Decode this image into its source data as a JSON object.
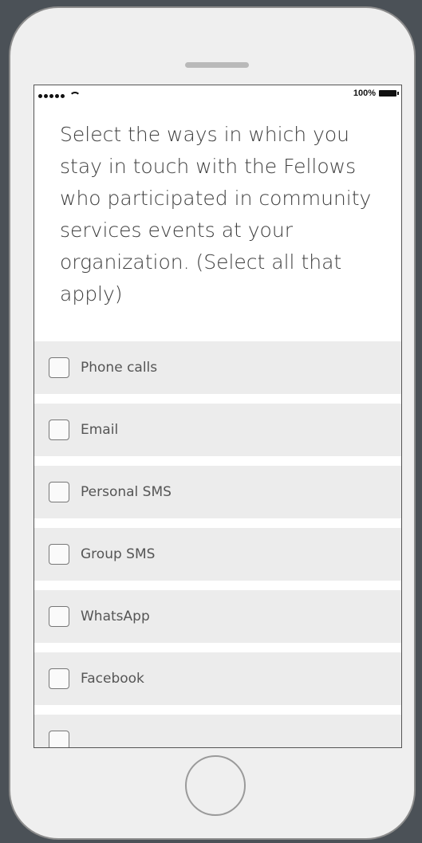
{
  "status_bar": {
    "battery_text": "100%"
  },
  "question": {
    "text": "Select the ways in which you stay in touch with the Fellows who participated in community services events at your organization. (Select all that apply)"
  },
  "options": [
    {
      "label": "Phone calls",
      "checked": false
    },
    {
      "label": "Email",
      "checked": false
    },
    {
      "label": "Personal SMS",
      "checked": false
    },
    {
      "label": "Group SMS",
      "checked": false
    },
    {
      "label": "WhatsApp",
      "checked": false
    },
    {
      "label": "Facebook",
      "checked": false
    },
    {
      "label": "",
      "checked": false
    }
  ]
}
